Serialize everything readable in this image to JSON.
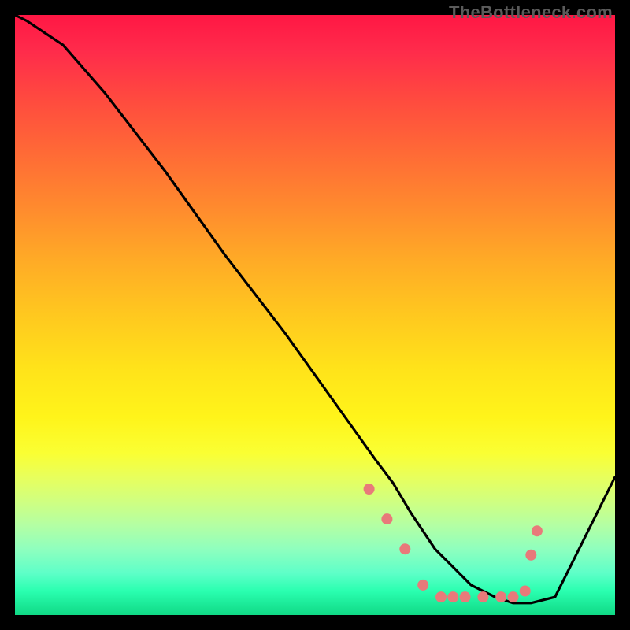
{
  "watermark": "TheBottleneck.com",
  "chart_data": {
    "type": "line",
    "title": "",
    "xlabel": "",
    "ylabel": "",
    "xlim": [
      0,
      100
    ],
    "ylim": [
      0,
      100
    ],
    "series": [
      {
        "name": "curve",
        "x": [
          0,
          2,
          5,
          8,
          15,
          25,
          35,
          45,
          55,
          60,
          63,
          66,
          70,
          73,
          76,
          80,
          83,
          86,
          90,
          93,
          96,
          100
        ],
        "values": [
          100,
          99,
          97,
          95,
          87,
          74,
          60,
          47,
          33,
          26,
          22,
          17,
          11,
          8,
          5,
          3,
          2,
          2,
          3,
          9,
          15,
          23
        ]
      }
    ],
    "markers": {
      "name": "dots",
      "x": [
        59,
        62,
        65,
        68,
        71,
        73,
        75,
        78,
        81,
        83,
        85,
        86,
        87
      ],
      "values": [
        21,
        16,
        11,
        5,
        3,
        3,
        3,
        3,
        3,
        3,
        4,
        10,
        14
      ],
      "color": "#e87a7a",
      "radius": 7
    },
    "colors": {
      "curve": "#000000",
      "background_top": "#ff1744",
      "background_bottom": "#10d985"
    }
  }
}
